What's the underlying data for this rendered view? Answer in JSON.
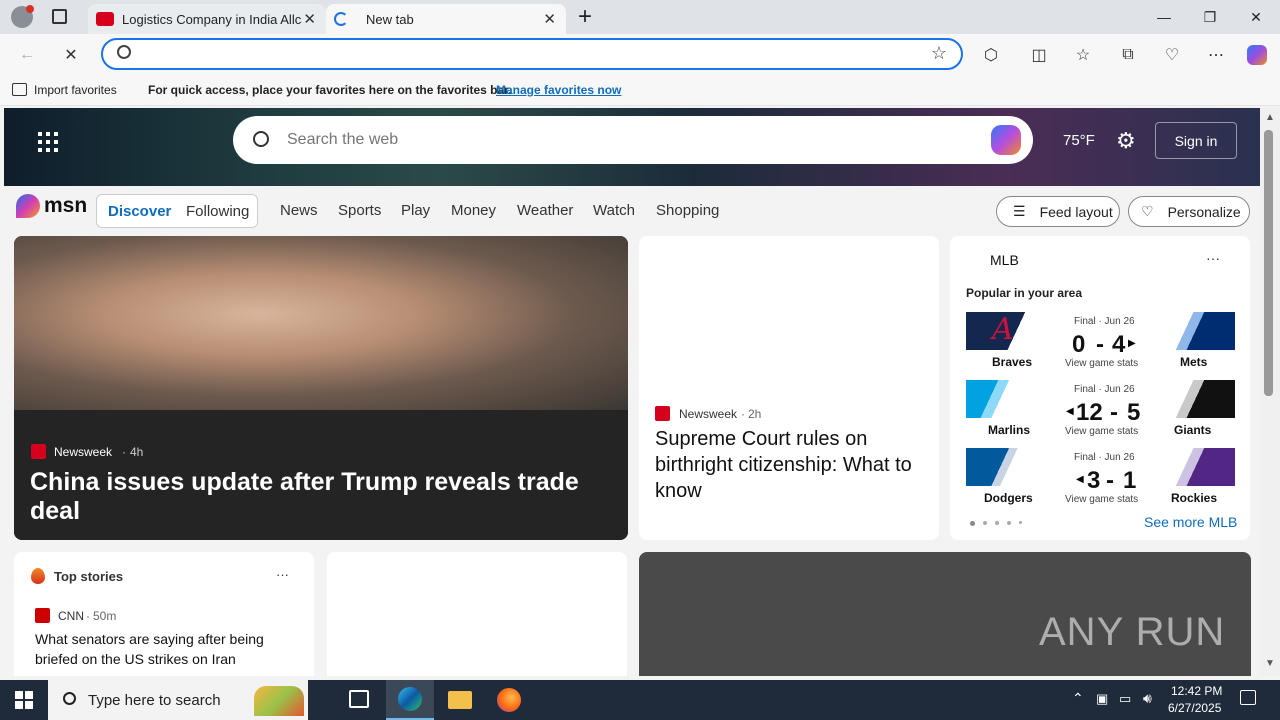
{
  "browser": {
    "tabs": [
      {
        "title": "Logistics Company in India Allcargo"
      },
      {
        "title": "New tab"
      }
    ],
    "new_tab_symbol": "+",
    "address": {
      "value": "",
      "placeholder": ""
    },
    "favorites_bar": {
      "import_label": "Import favorites",
      "message": "For quick access, place your favorites here on the favorites bar.",
      "manage_link": "Manage favorites now"
    }
  },
  "msn": {
    "search_placeholder": "Search the web",
    "weather": "75°F",
    "sign_in": "Sign in",
    "logo": "msn",
    "toggle": {
      "discover": "Discover",
      "following": "Following"
    },
    "nav": [
      "News",
      "Sports",
      "Play",
      "Money",
      "Weather",
      "Watch",
      "Shopping"
    ],
    "feed_layout": "Feed layout",
    "personalize": "Personalize"
  },
  "hero": {
    "source": "Newsweek",
    "age": "4h",
    "headline": "China issues update after Trump reveals trade deal"
  },
  "story2": {
    "source": "Newsweek",
    "age": "2h",
    "headline": "Supreme Court rules on birthright citizenship: What to know"
  },
  "mlb": {
    "title": "MLB",
    "subtitle": "Popular in your area",
    "games": [
      {
        "status": "Final · Jun 26",
        "home": "Braves",
        "away": "Mets",
        "score_home": "0",
        "score_away": "4",
        "winner": "right",
        "link": "View game stats"
      },
      {
        "status": "Final · Jun 26",
        "home": "Marlins",
        "away": "Giants",
        "score_home": "12",
        "score_away": "5",
        "winner": "left",
        "link": "View game stats"
      },
      {
        "status": "Final · Jun 26",
        "home": "Dodgers",
        "away": "Rockies",
        "score_home": "3",
        "score_away": "1",
        "winner": "left",
        "link": "View game stats"
      }
    ],
    "see_more": "See more MLB"
  },
  "top_stories": {
    "title": "Top stories",
    "items": [
      {
        "source": "CNN",
        "age": "50m",
        "headline": "What senators are saying after being briefed on the US strikes on Iran"
      }
    ]
  },
  "watermark": "ANY RUN",
  "taskbar": {
    "search_placeholder": "Type here to search",
    "time": "12:42 PM",
    "date": "6/27/2025"
  },
  "colors": {
    "accent": "#0f6cbd",
    "taskbar": "#1f2b3a",
    "newsweek": "#d6001c",
    "cnn": "#cc0000"
  }
}
